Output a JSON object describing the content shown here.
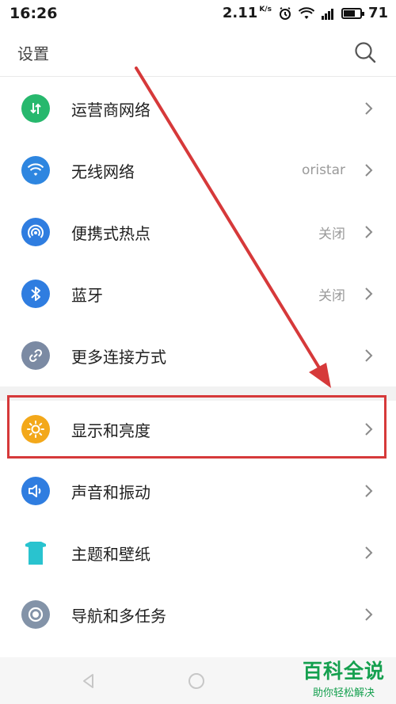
{
  "status_bar": {
    "time": "16:26",
    "speed": "2.11",
    "speed_unit": "K/s",
    "battery": "71",
    "battery_level": 0.71
  },
  "header": {
    "title": "设置"
  },
  "settings": [
    {
      "label": "运营商网络",
      "value": "",
      "icon": "cellular-data-icon",
      "color": "#27b86d"
    },
    {
      "label": "无线网络",
      "value": "oristar",
      "icon": "wifi-icon",
      "color": "#2e86e0"
    },
    {
      "label": "便携式热点",
      "value": "关闭",
      "icon": "hotspot-icon",
      "color": "#2f7de0"
    },
    {
      "label": "蓝牙",
      "value": "关闭",
      "icon": "bluetooth-icon",
      "color": "#2f7de0"
    },
    {
      "label": "更多连接方式",
      "value": "",
      "icon": "link-icon",
      "color": "#7b8aa3"
    },
    {
      "label": "显示和亮度",
      "value": "",
      "icon": "brightness-icon",
      "color": "#f3a81a"
    },
    {
      "label": "声音和振动",
      "value": "",
      "icon": "sound-icon",
      "color": "#2f7de0"
    },
    {
      "label": "主题和壁纸",
      "value": "",
      "icon": "theme-icon",
      "color": "#29c3cf"
    },
    {
      "label": "导航和多任务",
      "value": "",
      "icon": "navigation-icon",
      "color": "#8393a8"
    }
  ],
  "watermark": {
    "title": "百科全说",
    "subtitle": "助你轻松解决"
  }
}
